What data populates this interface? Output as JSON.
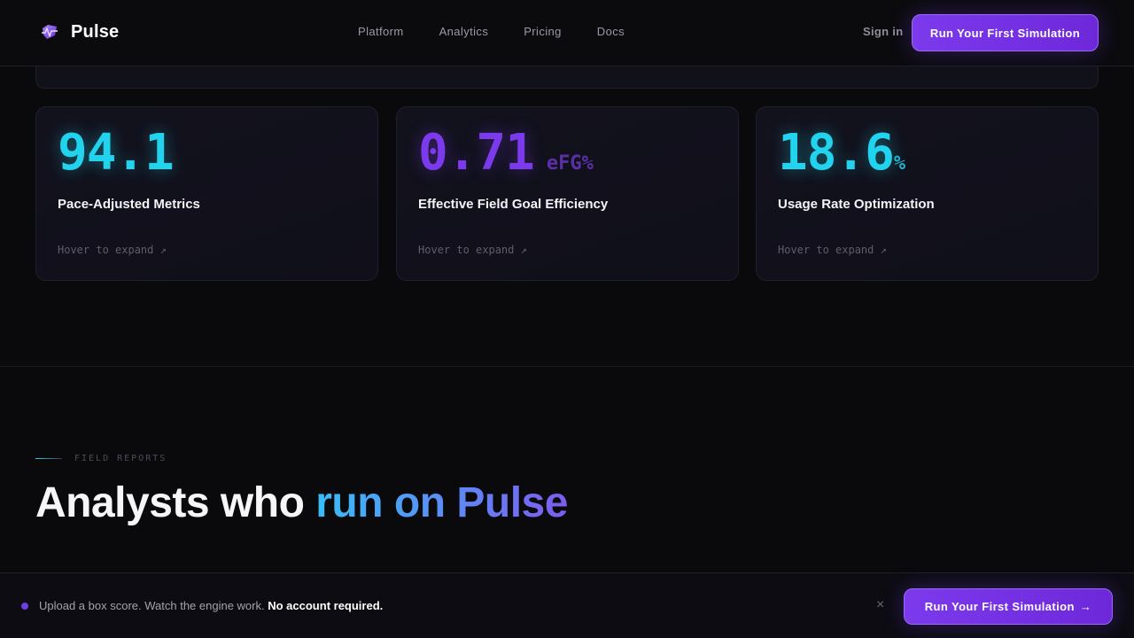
{
  "brand": {
    "name": "Pulse",
    "icon": "pulse-logo-icon"
  },
  "nav": {
    "links": [
      "Platform",
      "Analytics",
      "Pricing",
      "Docs"
    ],
    "sign_in": "Sign in",
    "cta": "Run Your First Simulation"
  },
  "stats": [
    {
      "value": "94.1",
      "unit": "",
      "label": "Pace-Adjusted Metrics",
      "hint": "Hover to expand ↗",
      "color": "#22d3ee"
    },
    {
      "value": "0.71",
      "unit": "eFG%",
      "label": "Effective Field Goal Efficiency",
      "hint": "Hover to expand ↗",
      "color": "#7c3aed"
    },
    {
      "value": "18.6",
      "unit": "%",
      "label": "Usage Rate Optimization",
      "hint": "Hover to expand ↗",
      "color": "#22d3ee"
    }
  ],
  "section": {
    "eyebrow": "FIELD REPORTS",
    "headline_plain": "Analysts who ",
    "headline_accent": "run on Pulse"
  },
  "bottom_bar": {
    "text": "Upload a box score. Watch the engine work.",
    "text_bold": "No account required.",
    "close": "×",
    "cta": "Run Your First Simulation",
    "cta_arrow": "→"
  },
  "colors": {
    "accent_violet": "#7c3aed",
    "accent_cyan": "#22d3ee",
    "background": "#0a0a0c"
  }
}
